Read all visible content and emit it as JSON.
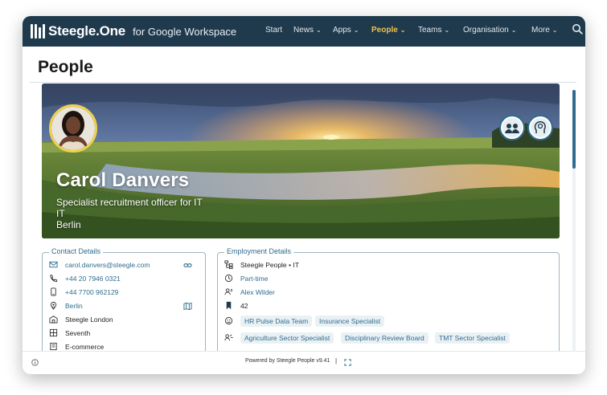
{
  "app": {
    "brand": "Steegle.One",
    "brand_suffix": "for Google Workspace",
    "nav": [
      {
        "label": "Start",
        "chevron": false,
        "active": false
      },
      {
        "label": "News",
        "chevron": true,
        "active": false
      },
      {
        "label": "Apps",
        "chevron": true,
        "active": false
      },
      {
        "label": "People",
        "chevron": true,
        "active": true
      },
      {
        "label": "Teams",
        "chevron": true,
        "active": false
      },
      {
        "label": "Organisation",
        "chevron": true,
        "active": false
      },
      {
        "label": "More",
        "chevron": true,
        "active": false
      }
    ],
    "accent": "#f2c14a",
    "topbar_color": "#1f3a4d"
  },
  "page": {
    "title": "People"
  },
  "profile": {
    "name": "Carol Danvers",
    "job_title": "Specialist recruitment officer for IT",
    "department": "IT",
    "location": "Berlin"
  },
  "contact": {
    "legend": "Contact Details",
    "rows": [
      {
        "icon": "email-icon",
        "value": "carol.danvers@steegle.com",
        "link": true,
        "action": "link-icon"
      },
      {
        "icon": "phone-icon",
        "value": "+44 20 7946 0321",
        "link": true
      },
      {
        "icon": "mobile-icon",
        "value": "+44 7700 962129",
        "link": true
      },
      {
        "icon": "location-pin-icon",
        "value": "Berlin",
        "link": true,
        "action": "map-icon"
      },
      {
        "icon": "building-icon",
        "value": "Steegle London",
        "link": false
      },
      {
        "icon": "floor-icon",
        "value": "Seventh",
        "link": false
      },
      {
        "icon": "desk-icon",
        "value": "E-commerce",
        "link": false
      }
    ]
  },
  "employment": {
    "legend": "Employment Details",
    "rows": [
      {
        "icon": "org-chart-icon",
        "value": "Steegle People • IT",
        "link": false
      },
      {
        "icon": "clock-icon",
        "value": "Part-time",
        "link": true
      },
      {
        "icon": "manager-icon",
        "value": "Alex Wilder",
        "link": true
      },
      {
        "icon": "bookmark-icon",
        "value": "42",
        "link": false
      }
    ],
    "tag_rows": [
      {
        "icon": "skills-icon",
        "tags": [
          "HR Pulse Data Team",
          "Insurance Specialist"
        ]
      },
      {
        "icon": "expertise-icon",
        "tags": [
          "Agriculture Sector Specialist",
          "Disciplinary Review Board",
          "TMT Sector Specialist"
        ]
      }
    ]
  },
  "footer": {
    "powered_by": "Powered by Steegle People v9.41",
    "separator": "|"
  }
}
